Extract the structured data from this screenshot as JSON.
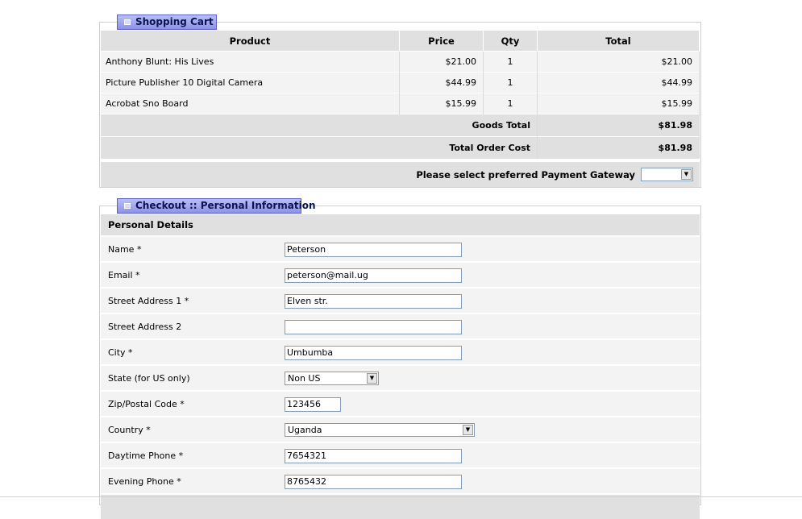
{
  "cart": {
    "title": "Shopping Cart",
    "headers": {
      "product": "Product",
      "price": "Price",
      "qty": "Qty",
      "total": "Total"
    },
    "items": [
      {
        "product": "Anthony Blunt: His Lives",
        "price": "$21.00",
        "qty": "1",
        "total": "$21.00"
      },
      {
        "product": "Picture Publisher 10 Digital Camera",
        "price": "$44.99",
        "qty": "1",
        "total": "$44.99"
      },
      {
        "product": "Acrobat Sno Board",
        "price": "$15.99",
        "qty": "1",
        "total": "$15.99"
      }
    ],
    "goods_total_label": "Goods Total",
    "goods_total_value": "$81.98",
    "order_total_label": "Total Order Cost",
    "order_total_value": "$81.98",
    "gateway_label": "Please select preferred Payment Gateway",
    "gateway_value": ""
  },
  "checkout": {
    "title": "Checkout :: Personal Information",
    "section_title": "Personal Details",
    "fields": [
      {
        "label": "Name *",
        "value": "Peterson"
      },
      {
        "label": "Email *",
        "value": "peterson@mail.ug"
      },
      {
        "label": "Street Address 1 *",
        "value": "Elven str."
      },
      {
        "label": "Street Address 2",
        "value": ""
      },
      {
        "label": "City *",
        "value": "Umbumba"
      },
      {
        "label": "State (for US only)",
        "value": "Non US"
      },
      {
        "label": "Zip/Postal Code *",
        "value": "123456"
      },
      {
        "label": "Country *",
        "value": "Uganda"
      },
      {
        "label": "Daytime Phone *",
        "value": "7654321"
      },
      {
        "label": "Evening Phone *",
        "value": "8765432"
      }
    ]
  }
}
